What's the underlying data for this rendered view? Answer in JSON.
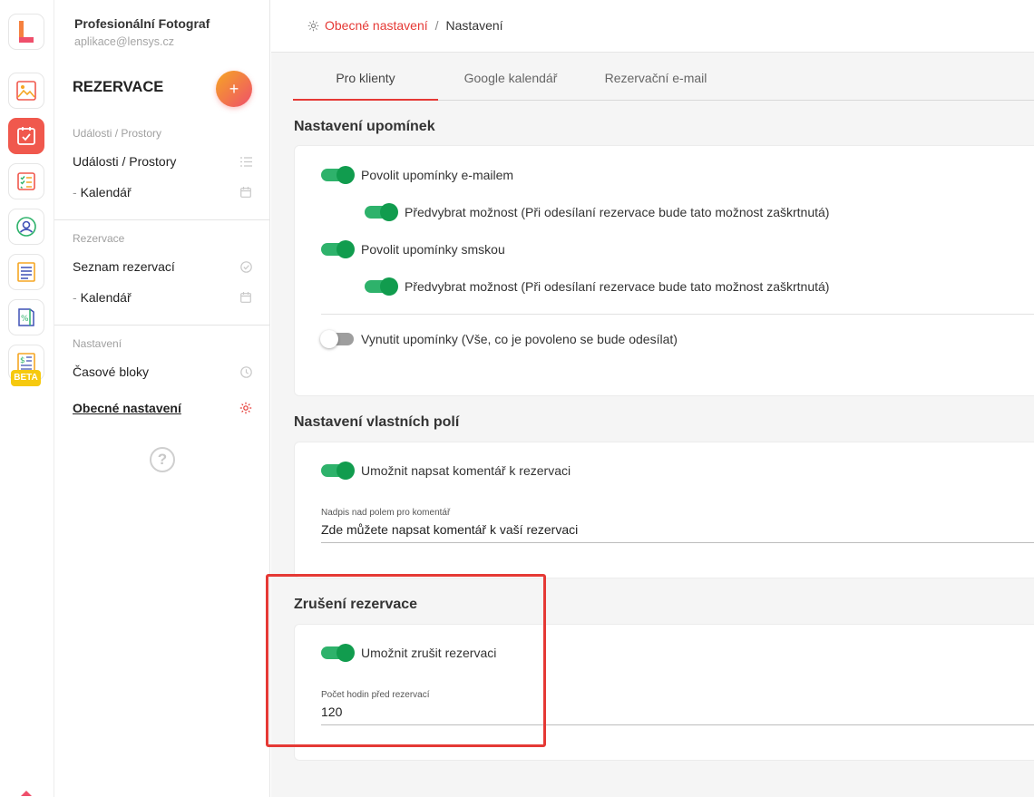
{
  "account": {
    "company": "Profesionální Fotograf",
    "email": "aplikace@lensys.cz"
  },
  "rail": {
    "beta": "BETA"
  },
  "nav": {
    "title": "REZERVACE",
    "add_label": "+",
    "sections": [
      {
        "label": "Události / Prostory",
        "items": [
          {
            "label": "Události / Prostory",
            "icon": "list-icon"
          },
          {
            "label": "Kalendář",
            "icon": "calendar-icon"
          }
        ]
      },
      {
        "label": "Rezervace",
        "items": [
          {
            "label": "Seznam rezervací",
            "icon": "check-circle-icon"
          },
          {
            "label": "Kalendář",
            "icon": "calendar-icon"
          }
        ]
      },
      {
        "label": "Nastavení",
        "items": [
          {
            "label": "Časové bloky",
            "icon": "clock-icon"
          },
          {
            "label": "Obecné nastavení",
            "icon": "gear-icon"
          }
        ]
      }
    ],
    "help": "?"
  },
  "breadcrumb": {
    "link": "Obecné nastavení",
    "separator": "/",
    "current": "Nastavení"
  },
  "tabs": [
    {
      "label": "Pro klienty",
      "active": true
    },
    {
      "label": "Google kalendář",
      "active": false
    },
    {
      "label": "Rezervační e-mail",
      "active": false
    }
  ],
  "reminders": {
    "title": "Nastavení upomínek",
    "email_toggle": "Povolit upomínky e-mailem",
    "email_preselect": "Předvybrat možnost (Při odesílaní rezervace bude tato možnost zaškrtnutá)",
    "sms_toggle": "Povolit upomínky smskou",
    "sms_preselect": "Předvybrat možnost (Při odesílaní rezervace bude tato možnost zaškrtnutá)",
    "force_toggle": "Vynutit upomínky (Vše, co je povoleno se bude odesílat)"
  },
  "custom_fields": {
    "title": "Nastavení vlastních polí",
    "comment_toggle": "Umožnit napsat komentář k rezervaci",
    "comment_field_label": "Nadpis nad polem pro komentář",
    "comment_field_value": "Zde můžete napsat komentář k vaší rezervaci"
  },
  "cancellation": {
    "title": "Zrušení rezervace",
    "cancel_toggle": "Umožnit zrušit rezervaci",
    "hours_label": "Počet hodin před rezervací",
    "hours_value": "120"
  },
  "colors": {
    "accent": "#e53935",
    "toggle_on": "#119c4e",
    "beta": "#f6c90e"
  }
}
